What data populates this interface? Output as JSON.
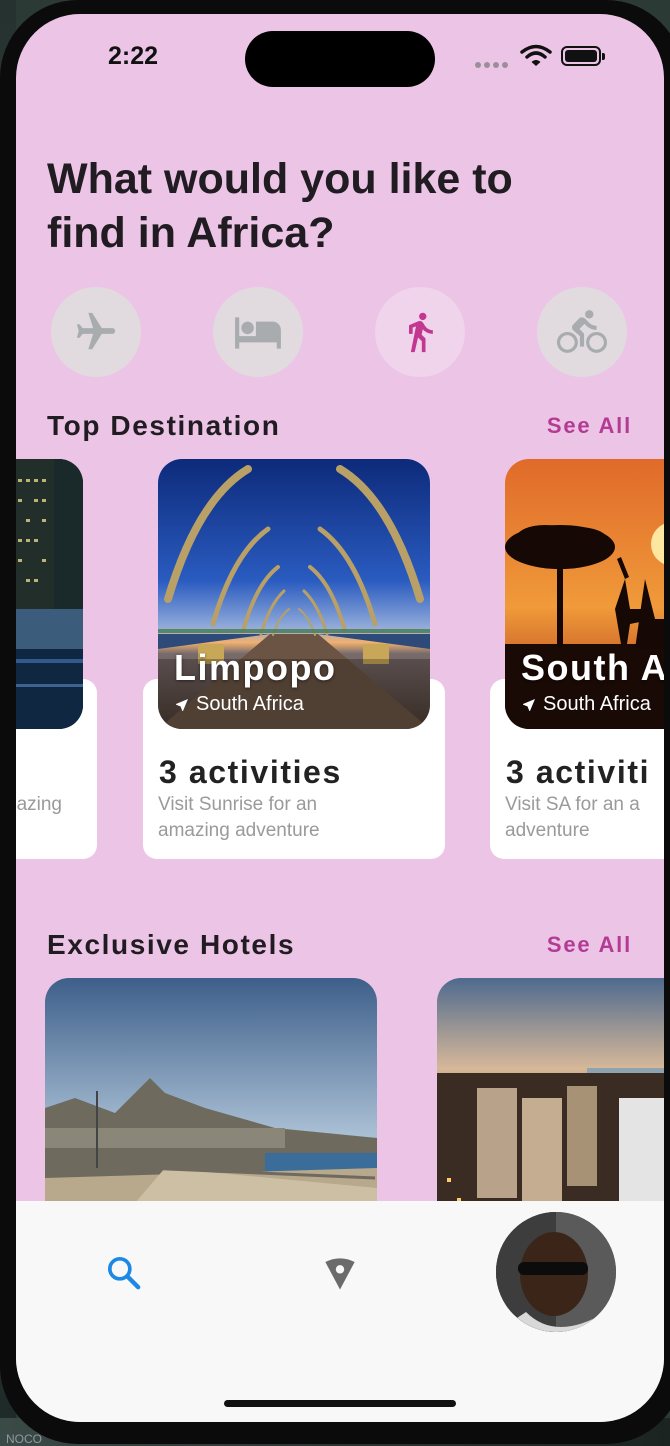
{
  "status": {
    "time": "2:22"
  },
  "headline": "What would you like to find in Africa?",
  "categories": [
    {
      "icon": "airplane-icon",
      "active": false
    },
    {
      "icon": "bed-icon",
      "active": false
    },
    {
      "icon": "walking-icon",
      "active": true
    },
    {
      "icon": "bicycle-icon",
      "active": false
    }
  ],
  "top_destination": {
    "title": "Top Destination",
    "see_all": "See All",
    "cards": [
      {
        "activities": "",
        "description": "nazing"
      },
      {
        "name": "Limpopo",
        "location": "South Africa",
        "activities": "3 activities",
        "description": "Visit Sunrise for an amazing adventure"
      },
      {
        "name": "South A",
        "location": "South Africa",
        "activities": "3 activiti",
        "description": "Visit SA for an a adventure"
      }
    ]
  },
  "exclusive_hotels": {
    "title": "Exclusive Hotels",
    "see_all": "See All"
  },
  "bottom_nav": {
    "items": [
      "search-icon",
      "map-pin-icon",
      "avatar"
    ]
  },
  "colors": {
    "background": "#ecc5e6",
    "accent": "#b43b94",
    "nav_active": "#1e88e5"
  }
}
